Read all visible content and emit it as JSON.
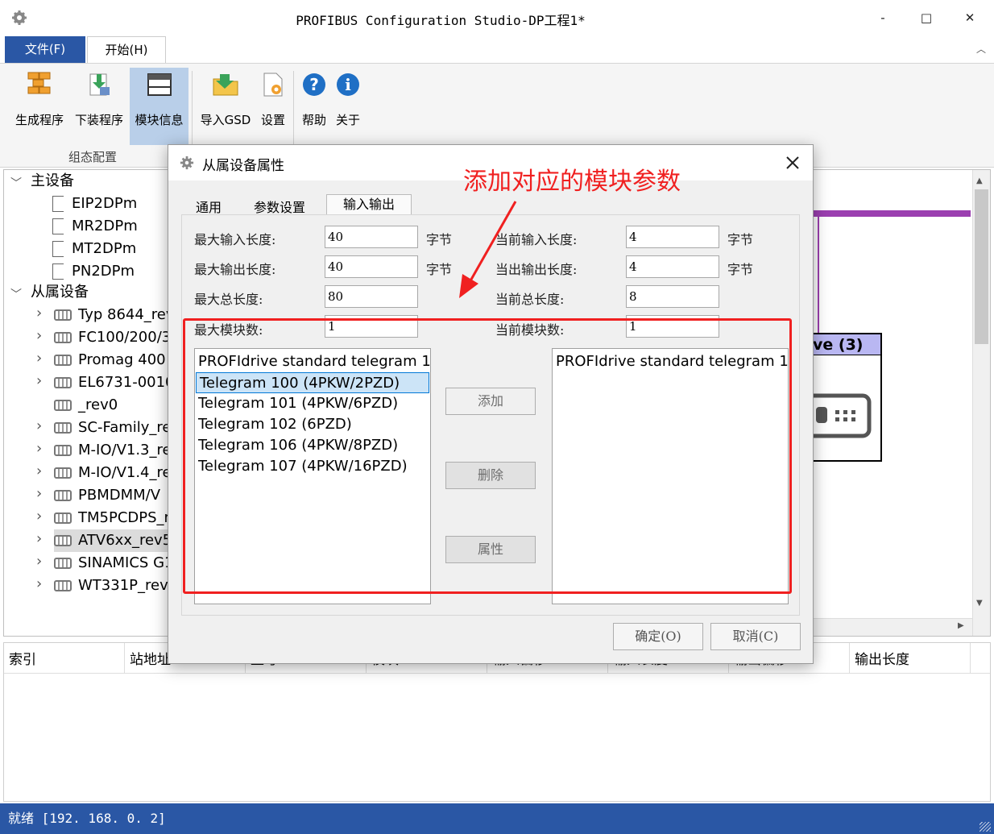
{
  "app": {
    "title": "PROFIBUS Configuration Studio-DP工程1*"
  },
  "window_controls": {
    "minimize": "-",
    "maximize": "□",
    "close": "✕"
  },
  "menu": {
    "file": "文件(F)",
    "home": "开始(H)"
  },
  "ribbon": {
    "buttons": [
      {
        "label": "生成程序",
        "icon": "bricks-icon"
      },
      {
        "label": "下装程序",
        "icon": "download-icon"
      },
      {
        "label": "模块信息",
        "icon": "window-icon"
      },
      {
        "label": "导入GSD",
        "icon": "folder-import-icon"
      },
      {
        "label": "设置",
        "icon": "settings-file-icon"
      },
      {
        "label": "帮助",
        "icon": "help-icon"
      },
      {
        "label": "关于",
        "icon": "info-icon"
      }
    ],
    "group_label": "组态配置"
  },
  "tree": {
    "master": "主设备",
    "masters": [
      "EIP2DPm",
      "MR2DPm",
      "MT2DPm",
      "PN2DPm"
    ],
    "slave": "从属设备",
    "slaves": [
      {
        "label": "Typ 8644_rev",
        "expandable": true
      },
      {
        "label": "FC100/200/3",
        "expandable": true
      },
      {
        "label": "Promag 400",
        "expandable": true
      },
      {
        "label": "EL6731-0010",
        "expandable": true
      },
      {
        "label": "_rev0",
        "expandable": false
      },
      {
        "label": "SC-Family_re",
        "expandable": true
      },
      {
        "label": "M-IO/V1.3_re",
        "expandable": true
      },
      {
        "label": "M-IO/V1.4_re",
        "expandable": true
      },
      {
        "label": "PBMDMM/V",
        "expandable": true
      },
      {
        "label": "TM5PCDPS_r",
        "expandable": true
      },
      {
        "label": "ATV6xx_rev5",
        "expandable": true,
        "selected": true
      },
      {
        "label": "SINAMICS G1",
        "expandable": true
      },
      {
        "label": "WT331P_rev0",
        "expandable": true
      }
    ]
  },
  "canvas": {
    "device_label": "ve (3)"
  },
  "grid": {
    "columns": [
      "索引",
      "站地址",
      "型号",
      "模块",
      "输入偏移",
      "输入长度",
      "输出偏移",
      "输出长度"
    ]
  },
  "status": {
    "text": "就绪 [192. 168. 0. 2]"
  },
  "dialog": {
    "title": "从属设备属性",
    "tabs": [
      "通用",
      "参数设置",
      "输入输出"
    ],
    "active_tab": "输入输出",
    "fields": {
      "max_input_label": "最大输入长度:",
      "max_input": "40",
      "max_output_label": "最大输出长度:",
      "max_output": "40",
      "max_total_label": "最大总长度:",
      "max_total": "80",
      "max_modules_label": "最大模块数:",
      "max_modules": "1",
      "cur_input_label": "当前输入长度:",
      "cur_input": "4",
      "cur_output_label": "当出输出长度:",
      "cur_output": "4",
      "cur_total_label": "当前总长度:",
      "cur_total": "8",
      "cur_modules_label": "当前模块数:",
      "cur_modules": "1",
      "unit": "字节"
    },
    "available_modules": [
      "PROFIdrive standard telegram 1",
      "Telegram 100 (4PKW/2PZD)",
      "Telegram 101 (4PKW/6PZD)",
      "Telegram 102 (6PZD)",
      "Telegram 106 (4PKW/8PZD)",
      "Telegram 107 (4PKW/16PZD)"
    ],
    "selected_module_index": 1,
    "configured_modules": [
      "PROFIdrive standard telegram 1"
    ],
    "buttons": {
      "add": "添加",
      "delete": "删除",
      "properties": "属性",
      "ok": "确定(O)",
      "cancel": "取消(C)"
    }
  },
  "annotation": {
    "text": "添加对应的模块参数",
    "color": "#f02020"
  }
}
